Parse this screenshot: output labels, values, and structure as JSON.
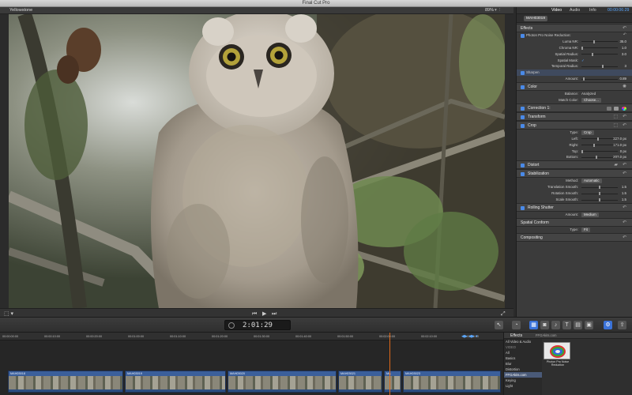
{
  "window": {
    "title": "Final Cut Pro"
  },
  "viewer": {
    "name": "Yellowstone",
    "zoom": "89%",
    "zoom_chevron": "▾",
    "switcher": "⫶",
    "controls": {
      "transform_icon": "⬚ ▾",
      "prev": "⏮",
      "play": "▶",
      "next": "⏭",
      "fullscreen": "⤢"
    }
  },
  "inspector": {
    "tabs": {
      "video": "Video",
      "audio": "Audio",
      "info": "Info",
      "timecode": "00:00:06:29"
    },
    "clip_name": "MAH03019",
    "sections": {
      "effects": "Effects",
      "photon": "Photon Pro Noise Reduction:",
      "luma_nr": {
        "label": "Luma NR:",
        "value": "35.0",
        "level": 0.35
      },
      "chroma_nr": {
        "label": "Chroma NR:",
        "value": "1.0",
        "level": 0.01
      },
      "spatial_radius": {
        "label": "Spatial Radius:",
        "value": "3.0",
        "level": 0.3
      },
      "spatial_mask": {
        "label": "Spatial Mask:",
        "value": "✓"
      },
      "temporal_radius": {
        "label": "Temporal Radius:",
        "value": "3",
        "level": 0.6
      },
      "sharpen": "Sharpen",
      "sharpen_amount": {
        "label": "Amount:",
        "value": "0.89",
        "level": 0.05
      },
      "color": "Color",
      "balance": {
        "label": "Balance:",
        "value": "Analyzed"
      },
      "match_color": {
        "label": "Match Color:",
        "value": "Choose..."
      },
      "correction": "Correction 1:",
      "transform": "Transform",
      "crop": "Crop",
      "crop_type": {
        "label": "Type:",
        "value": "Crop"
      },
      "crop_left": {
        "label": "Left:",
        "value": "327.0 px",
        "level": 0.45
      },
      "crop_right": {
        "label": "Right:",
        "value": "171.0 px",
        "level": 0.35
      },
      "crop_top": {
        "label": "Top:",
        "value": "0 px",
        "level": 0.0
      },
      "crop_bottom": {
        "label": "Bottom:",
        "value": "207.0 px",
        "level": 0.4
      },
      "distort": "Distort",
      "stabilization": "Stabilization",
      "method": {
        "label": "Method:",
        "value": "Automatic"
      },
      "translation_smooth": {
        "label": "Translation Smooth:",
        "value": "1.5",
        "level": 0.5
      },
      "rotation_smooth": {
        "label": "Rotation Smooth:",
        "value": "1.5",
        "level": 0.5
      },
      "scale_smooth": {
        "label": "Scale Smooth:",
        "value": "1.5",
        "level": 0.5
      },
      "rolling_shutter": "Rolling Shutter",
      "rs_amount": {
        "label": "Amount:",
        "value": "Medium"
      },
      "spatial_conform": "Spatial Conform",
      "sc_type": {
        "label": "Type:",
        "value": "Fit"
      },
      "compositing": "Compositing"
    }
  },
  "toolbar": {
    "timecode": "2:01:29"
  },
  "timeline": {
    "ruler": [
      "00:00:00:00",
      "00:00:10:00",
      "00:00:20:00",
      "00:01:00:00",
      "00:01:10:00",
      "00:01:20:00",
      "00:01:30:00",
      "00:01:40:00",
      "00:01:50:00",
      "00:02:00:00",
      "00:02:10:00",
      "00:02:20:00"
    ],
    "clips": [
      {
        "label": "MAH03018"
      },
      {
        "label": "MAH03019"
      },
      {
        "label": "MAH03020"
      },
      {
        "label": "MAH03021"
      },
      {
        "label": "MA"
      },
      {
        "label": "MAH03023"
      }
    ]
  },
  "effects_browser": {
    "title": "Effects",
    "search": "FFGAkits.com",
    "categories": [
      "All Video & Audio",
      "VIDEO",
      "All",
      "Basics",
      "Blur",
      "Distortion",
      "FFGAkits.com",
      "Keying",
      "Light"
    ],
    "selected_category": "FFGAkits.com",
    "item": "Photon Pro Noise Reduction"
  },
  "colors": {
    "accent": "#3a72d8",
    "playhead": "#e06a1a",
    "clip": "#3b5f9b"
  }
}
